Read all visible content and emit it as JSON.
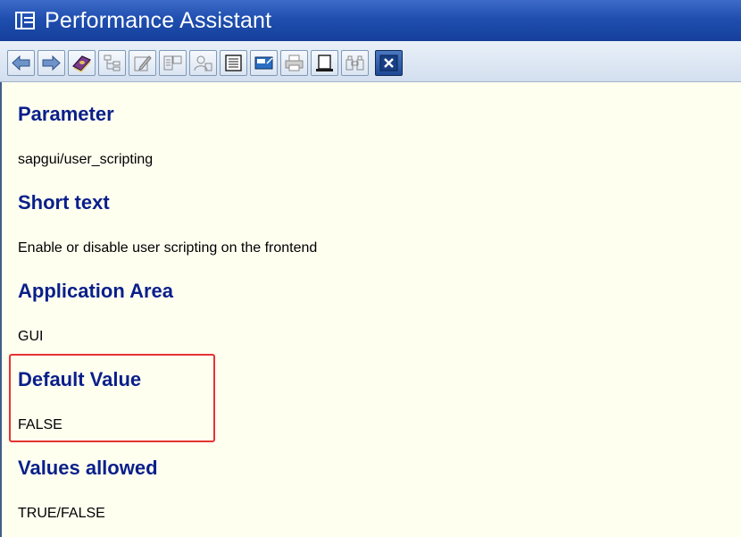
{
  "window": {
    "title": "Performance Assistant"
  },
  "toolbar": {
    "buttons": [
      {
        "icon": "back-arrow-icon"
      },
      {
        "icon": "forward-arrow-icon"
      },
      {
        "icon": "help-book-icon"
      },
      {
        "icon": "hierarchy-icon"
      },
      {
        "icon": "edit-note-icon"
      },
      {
        "icon": "glossary-icon"
      },
      {
        "icon": "user-note-icon"
      },
      {
        "icon": "list-icon"
      },
      {
        "icon": "technical-info-icon"
      },
      {
        "icon": "print-icon"
      },
      {
        "icon": "page-icon"
      },
      {
        "icon": "binoculars-icon"
      },
      {
        "icon": "close-icon"
      }
    ]
  },
  "sections": [
    {
      "heading": "Parameter",
      "value": "sapgui/user_scripting"
    },
    {
      "heading": "Short text",
      "value": "Enable or disable user scripting on the frontend"
    },
    {
      "heading": "Application Area",
      "value": "GUI"
    },
    {
      "heading": "Default Value",
      "value": "FALSE"
    },
    {
      "heading": "Values allowed",
      "value": "TRUE/FALSE"
    }
  ],
  "highlight": {
    "section": "Application Area",
    "color": "#e53333"
  }
}
